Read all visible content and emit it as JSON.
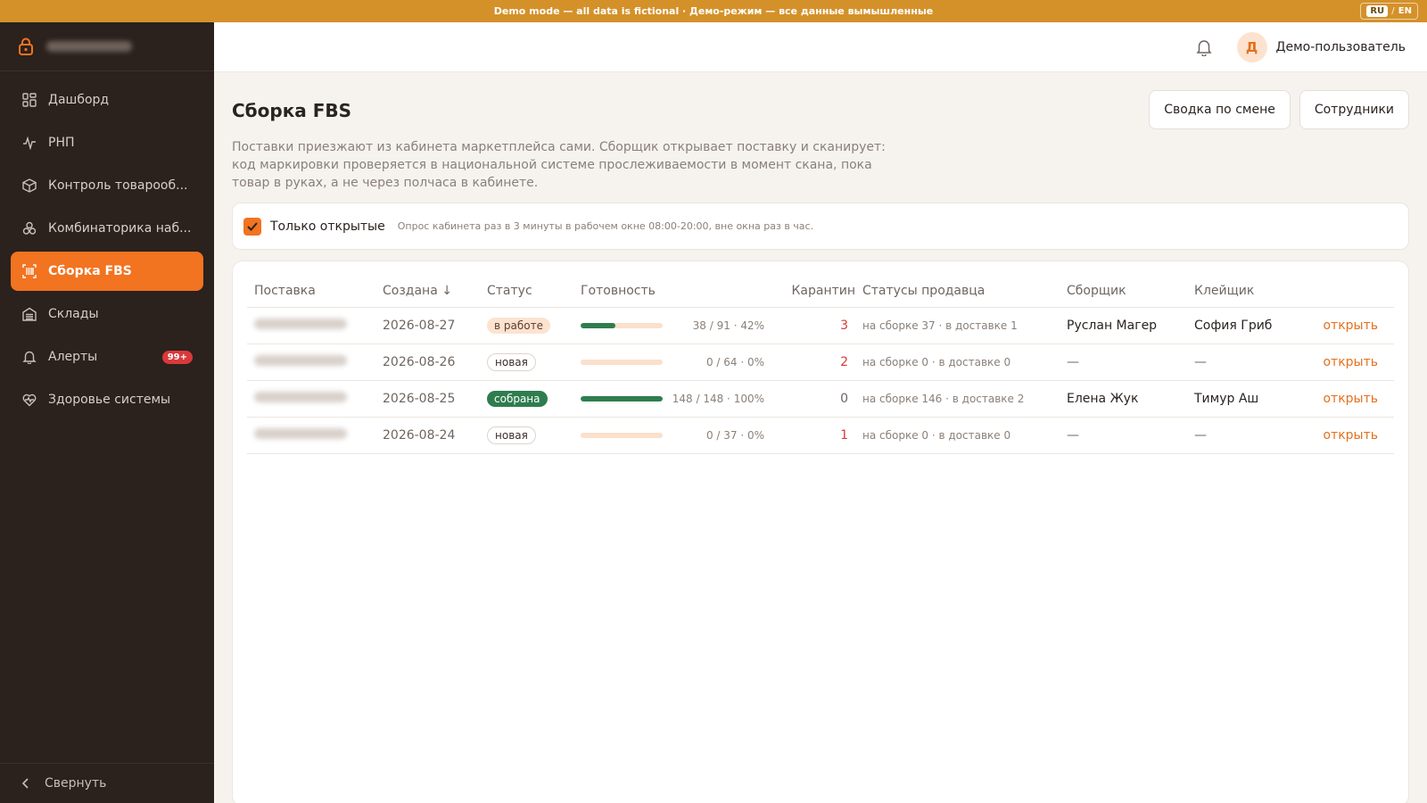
{
  "demo_banner": "Demo mode — all data is fictional · Демо-режим — все данные вымышленные",
  "lang": {
    "ru": "RU",
    "sep": "/",
    "en": "EN"
  },
  "sidebar": {
    "items": [
      {
        "label": "Дашборд",
        "icon": "dashboard-icon"
      },
      {
        "label": "РНП",
        "icon": "pulse-icon"
      },
      {
        "label": "Контроль товарооб...",
        "icon": "box-icon"
      },
      {
        "label": "Комбинаторика наб...",
        "icon": "combo-icon"
      },
      {
        "label": "Сборка FBS",
        "icon": "barcode-icon",
        "active": true
      },
      {
        "label": "Склады",
        "icon": "warehouse-icon"
      },
      {
        "label": "Алерты",
        "icon": "bell-icon",
        "badge": "99+"
      },
      {
        "label": "Здоровье системы",
        "icon": "heart-icon"
      }
    ],
    "collapse": "Свернуть"
  },
  "user": {
    "initial": "Д",
    "name": "Демо-пользователь"
  },
  "page": {
    "title": "Сборка FBS",
    "btn_summary": "Сводка по смене",
    "btn_staff": "Сотрудники",
    "description": "Поставки приезжают из кабинета маркетплейса сами. Сборщик открывает поставку и сканирует: код маркировки проверяется в национальной системе прослеживаемости в момент скана, пока товар в руках, а не через полчаса в кабинете.",
    "filter_label": "Только открытые",
    "filter_note": "Опрос кабинета раз в 3 минуты в рабочем окне 08:00-20:00, вне окна раз в час."
  },
  "table": {
    "headers": {
      "supply": "Поставка",
      "created": "Создана ↓",
      "status": "Статус",
      "ready": "Готовность",
      "quarantine": "Карантин",
      "seller_statuses": "Статусы продавца",
      "picker": "Сборщик",
      "labeler": "Клейщик"
    },
    "rows": [
      {
        "created": "2026-08-27",
        "status": "в работе",
        "status_kind": "work",
        "fraction": 0.42,
        "progress": "38 / 91 · 42%",
        "quarantine": "3",
        "seller": "на сборке 37 · в доставке 1",
        "picker": "Руслан Магер",
        "labeler": "София Гриб",
        "action": "открыть"
      },
      {
        "created": "2026-08-26",
        "status": "новая",
        "status_kind": "new",
        "fraction": 0,
        "progress": "0 / 64 · 0%",
        "quarantine": "2",
        "seller": "на сборке 0 · в доставке 0",
        "picker": "—",
        "labeler": "—",
        "action": "открыть"
      },
      {
        "created": "2026-08-25",
        "status": "собрана",
        "status_kind": "done",
        "fraction": 1,
        "progress": "148 / 148 · 100%",
        "quarantine": "0",
        "seller": "на сборке 146 · в доставке 2",
        "picker": "Елена Жук",
        "labeler": "Тимур Аш",
        "action": "открыть"
      },
      {
        "created": "2026-08-24",
        "status": "новая",
        "status_kind": "new",
        "fraction": 0,
        "progress": "0 / 37 · 0%",
        "quarantine": "1",
        "seller": "на сборке 0 · в доставке 0",
        "picker": "—",
        "labeler": "—",
        "action": "открыть"
      }
    ]
  },
  "colors": {
    "accent": "#f27320",
    "success": "#2f7d4f",
    "danger": "#d9393a",
    "banner": "#d4912a",
    "sidebar": "#2b211d"
  }
}
